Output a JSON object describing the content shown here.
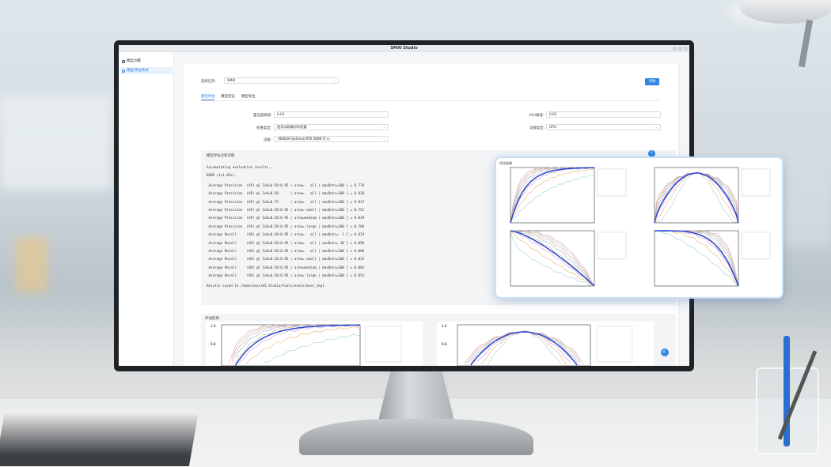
{
  "window": {
    "title": "SMAI Studio"
  },
  "sidebar": {
    "items": [
      {
        "label": "模型训练",
        "icon": "train-icon"
      },
      {
        "label": "模型评估测试",
        "icon": "eval-icon"
      }
    ]
  },
  "form": {
    "task_label": "选择任务:",
    "task_value": "SMAI",
    "start_label": "开始",
    "tabs": [
      "模型评估",
      "模型验证",
      "模型导出"
    ],
    "conf_label": "置信度阈值:",
    "conf_value": "0.03",
    "iou_label": "IOU阈值:",
    "iou_value": "0.65",
    "weights_label": "权重类型:",
    "weights_value": "使用训练最好的权重",
    "device_type_label": "设备类型:",
    "device_type_value": "GPU",
    "device_label": "设备:",
    "device_value": "NVIDIA GeForce RTX 3090 Ti"
  },
  "log": {
    "title": "模型评估过程详情",
    "lines": [
      "Accumulating evaluation results...",
      "DONE (t=1.03s).",
      " Average Precision  (AP) @[ IoU=0.50:0.95 | area=   all | maxDets=100 ] = 0.778",
      " Average Precision  (AP) @[ IoU=0.50      | area=   all | maxDets=100 ] = 0.938",
      " Average Precision  (AP) @[ IoU=0.75      | area=   all | maxDets=100 ] = 0.917",
      " Average Precision  (AP) @[ IoU=0.50:0.95 | area= small | maxDets=100 ] = 0.751",
      " Average Precision  (AP) @[ IoU=0.50:0.95 | area=medium | maxDets=100 ] = 0.839",
      " Average Precision  (AP) @[ IoU=0.50:0.95 | area= large | maxDets=100 ] = 0.760",
      " Average Recall     (AR) @[ IoU=0.50:0.95 | area=   all | maxDets=  1 ] = 0.624",
      " Average Recall     (AR) @[ IoU=0.50:0.95 | area=   all | maxDets= 10 ] = 0.858",
      " Average Recall     (AR) @[ IoU=0.50:0.95 | area=   all | maxDets=100 ] = 0.868",
      " Average Recall     (AR) @[ IoU=0.50:0.95 | area= small | maxDets=100 ] = 0.835",
      " Average Recall     (AR) @[ IoU=0.50:0.95 | area=medium | maxDets=100 ] = 0.884",
      " Average Recall     (AR) @[ IoU=0.50:0.95 | area= large | maxDets=100 ] = 0.853",
      "Results saved to /home/xxx/xAI_Studio/tools/evals/best_ckpt"
    ]
  },
  "popup": {
    "header": "评估结果"
  },
  "results": {
    "title": "评估结果:",
    "tick_1": "1.0",
    "tick_08": "0.8"
  },
  "colors": {
    "accent": "#2f86e6",
    "mean_curve": "#1f3fd6"
  }
}
